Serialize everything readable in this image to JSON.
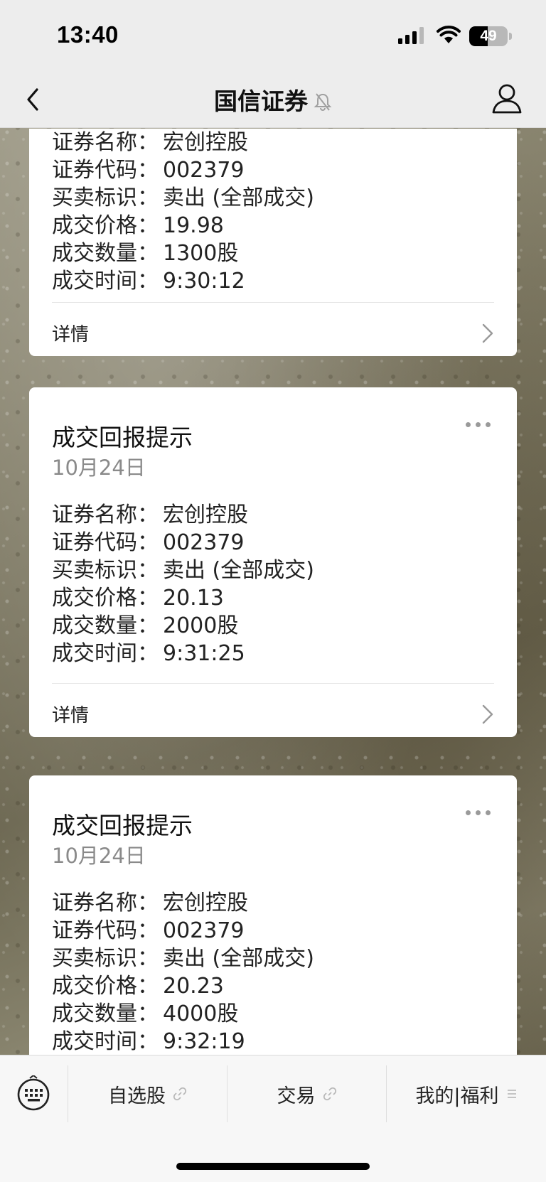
{
  "status_bar": {
    "time": "13:40",
    "battery_text": "49",
    "battery_level": 0.49
  },
  "nav": {
    "title": "国信证券"
  },
  "cards": [
    {
      "title": "",
      "date": "",
      "fields": [
        {
          "label": "证券名称：",
          "value": "宏创控股"
        },
        {
          "label": "证券代码：",
          "value": "002379"
        },
        {
          "label": "买卖标识：",
          "value": "卖出 (全部成交)"
        },
        {
          "label": "成交价格：",
          "value": "19.98"
        },
        {
          "label": "成交数量：",
          "value": "1300股"
        },
        {
          "label": "成交时间：",
          "value": "9:30:12"
        }
      ],
      "detail_label": "详情"
    },
    {
      "title": "成交回报提示",
      "date": "10月24日",
      "fields": [
        {
          "label": "证券名称：",
          "value": "宏创控股"
        },
        {
          "label": "证券代码：",
          "value": "002379"
        },
        {
          "label": "买卖标识：",
          "value": "卖出 (全部成交)"
        },
        {
          "label": "成交价格：",
          "value": "20.13"
        },
        {
          "label": "成交数量：",
          "value": "2000股"
        },
        {
          "label": "成交时间：",
          "value": "9:31:25"
        }
      ],
      "detail_label": "详情"
    },
    {
      "title": "成交回报提示",
      "date": "10月24日",
      "fields": [
        {
          "label": "证券名称：",
          "value": "宏创控股"
        },
        {
          "label": "证券代码：",
          "value": "002379"
        },
        {
          "label": "买卖标识：",
          "value": "卖出 (全部成交)"
        },
        {
          "label": "成交价格：",
          "value": "20.23"
        },
        {
          "label": "成交数量：",
          "value": "4000股"
        },
        {
          "label": "成交时间：",
          "value": "9:32:19"
        }
      ],
      "detail_label": ""
    }
  ],
  "bottom_menu": {
    "items": [
      {
        "label": "自选股",
        "icon": "link-icon"
      },
      {
        "label": "交易",
        "icon": "link-icon"
      },
      {
        "label": "我的|福利",
        "icon": "menu-icon"
      }
    ]
  }
}
